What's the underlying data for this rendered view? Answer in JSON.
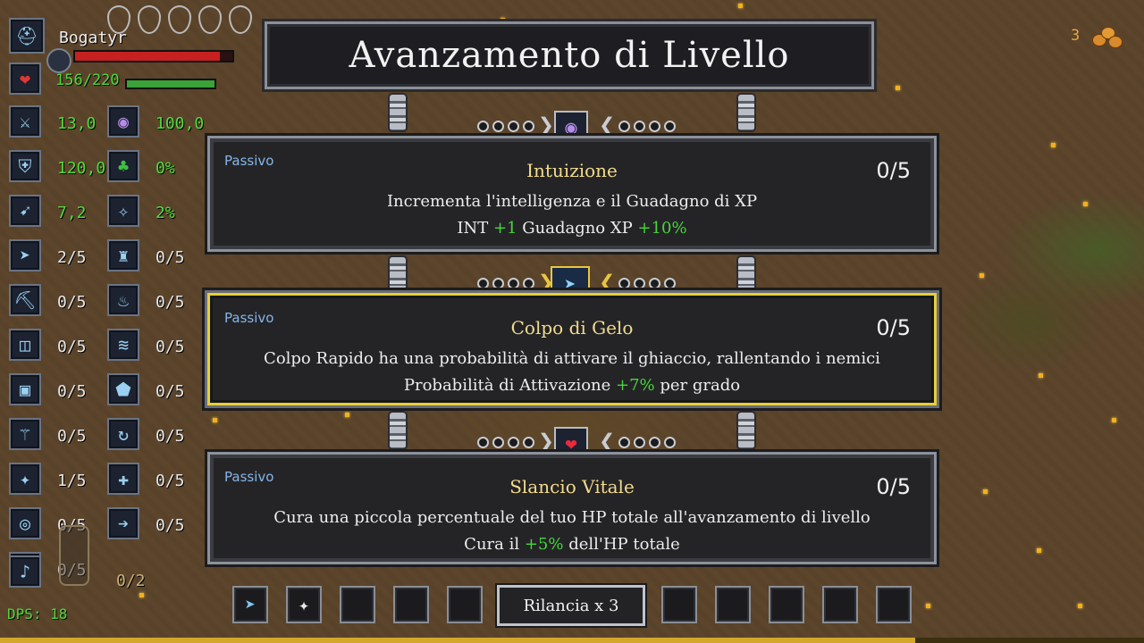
{
  "player": {
    "name": "Bogatyr",
    "hp": "156/220",
    "dps": "DPS: 18",
    "slots_counter": "0/2"
  },
  "top_right": {
    "coins": "3"
  },
  "title": "Avanzamento di Livello",
  "stats_left": [
    {
      "icon": "sword-plus-icon",
      "value": "13,0"
    },
    {
      "icon": "shield-icon",
      "value": "120,0"
    },
    {
      "icon": "boot-speed-icon",
      "value": "7,2"
    },
    {
      "icon": "frost-arrow-icon",
      "value": "2/5"
    },
    {
      "icon": "pickaxe-icon",
      "value": "0/5"
    },
    {
      "icon": "barrier-icon",
      "value": "0/5"
    },
    {
      "icon": "armor-icon",
      "value": "0/5"
    },
    {
      "icon": "blade-icon",
      "value": "0/5"
    },
    {
      "icon": "dash-icon",
      "value": "1/5"
    },
    {
      "icon": "ring-icon",
      "value": "0/5"
    },
    {
      "icon": "horn-icon",
      "value": "0/5"
    }
  ],
  "stats_right": [
    {
      "icon": "eye-icon",
      "value": "100,0"
    },
    {
      "icon": "clover-icon",
      "value": "0%"
    },
    {
      "icon": "crit-hand-icon",
      "value": "2%"
    },
    {
      "icon": "statue-icon",
      "value": "0/5"
    },
    {
      "icon": "flame-icon",
      "value": "0/5"
    },
    {
      "icon": "wind-icon",
      "value": "0/5"
    },
    {
      "icon": "pentagon-icon",
      "value": "0/5"
    },
    {
      "icon": "whirl-icon",
      "value": "0/5"
    },
    {
      "icon": "sparkle-icon",
      "value": "0/5"
    },
    {
      "icon": "arrow-icon",
      "value": "0/5"
    }
  ],
  "cards": [
    {
      "kind": "Passivo",
      "name": "Intuizione",
      "rank": "0/5",
      "desc": "Incrementa l'intelligenza e il Guadagno di XP",
      "eff": [
        {
          "t": "INT "
        },
        {
          "t": "+1",
          "g": true
        },
        {
          "t": "  Guadagno XP "
        },
        {
          "t": "+10%",
          "g": true
        }
      ],
      "icon": "eye-icon",
      "selected": false
    },
    {
      "kind": "Passivo",
      "name": "Colpo di Gelo",
      "rank": "0/5",
      "desc": "Colpo Rapido ha una probabilità di attivare il ghiaccio, rallentando i nemici",
      "eff": [
        {
          "t": "Probabilità di Attivazione "
        },
        {
          "t": "+7%",
          "g": true
        },
        {
          "t": "  per grado"
        }
      ],
      "icon": "frost-arrow-icon",
      "selected": true
    },
    {
      "kind": "Passivo",
      "name": "Slancio Vitale",
      "rank": "0/5",
      "desc": "Cura una piccola percentuale del tuo HP totale all'avanzamento di livello",
      "eff": [
        {
          "t": "Cura il "
        },
        {
          "t": "+5%",
          "g": true
        },
        {
          "t": " dell'HP totale"
        }
      ],
      "icon": "heart-icon",
      "selected": false
    }
  ],
  "reroll": {
    "label": "Rilancia x 3"
  }
}
